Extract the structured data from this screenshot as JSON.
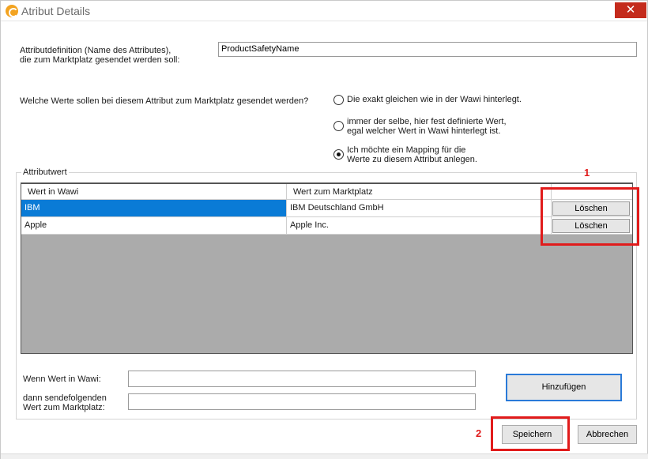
{
  "window": {
    "title": "Atribut Details",
    "close_glyph": "✕"
  },
  "form": {
    "definition_label_line1": "Attributdefinition (Name des Attributes),",
    "definition_label_line2": "die zum Marktplatz gesendet werden soll:",
    "definition_value": "ProductSafetyName",
    "question_label": "Welche Werte sollen bei diesem Attribut zum Marktplatz gesendet werden?",
    "options": [
      {
        "line1": "Die exakt gleichen wie in der Wawi hinterlegt.",
        "line2": "",
        "checked": false
      },
      {
        "line1": "immer der selbe, hier fest definierte Wert,",
        "line2": "egal welcher Wert in Wawi hinterlegt ist.",
        "checked": false
      },
      {
        "line1": "Ich möchte ein Mapping für die",
        "line2": "Werte zu diesem Attribut anlegen.",
        "checked": true
      }
    ]
  },
  "group": {
    "caption": "Attributwert",
    "columns": [
      "Wert in Wawi",
      "Wert zum Marktplatz"
    ],
    "rows": [
      {
        "wawi": "IBM",
        "marktplatz": "IBM Deutschland GmbH",
        "action": "Löschen",
        "selected": true
      },
      {
        "wawi": "Apple",
        "marktplatz": "Apple Inc.",
        "action": "Löschen",
        "selected": false
      }
    ],
    "when_label": "Wenn Wert in Wawi:",
    "when_value": "",
    "send_label_line1": "dann sendefolgenden",
    "send_label_line2": "Wert zum Marktplatz:",
    "send_value": "",
    "add_button": "Hinzufügen"
  },
  "footer": {
    "save_button": "Speichern",
    "cancel_button": "Abbrechen"
  },
  "annotations": {
    "marker_1": "1",
    "marker_2": "2",
    "color": "#e11b1b"
  },
  "colors": {
    "selection": "#0a7bd6",
    "grid_empty": "#ababab",
    "close_button": "#c42b1c",
    "primary_border": "#2a7ad8"
  }
}
